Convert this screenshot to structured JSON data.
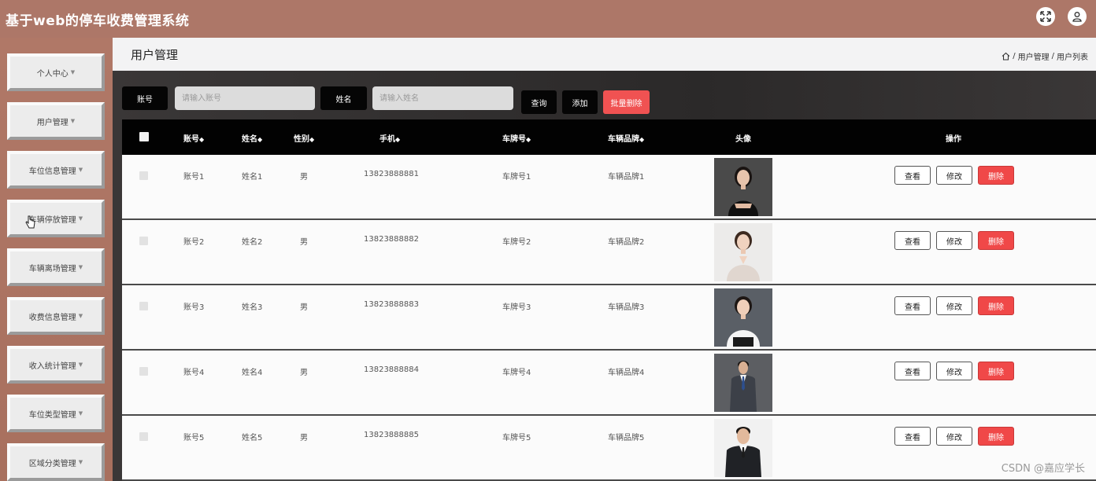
{
  "header": {
    "title": "基于web的停车收费管理系统",
    "icons": [
      "fullscreen-icon",
      "user-icon"
    ]
  },
  "sidebar": {
    "items": [
      {
        "label": "个人中心"
      },
      {
        "label": "用户管理"
      },
      {
        "label": "车位信息管理"
      },
      {
        "label": "车辆停放管理"
      },
      {
        "label": "车辆离场管理"
      },
      {
        "label": "收费信息管理"
      },
      {
        "label": "收入统计管理"
      },
      {
        "label": "车位类型管理"
      },
      {
        "label": "区域分类管理"
      }
    ]
  },
  "page": {
    "title": "用户管理",
    "breadcrumb": {
      "level1": "用户管理",
      "level2": "用户列表",
      "separator": "/"
    }
  },
  "search": {
    "account_label": "账号",
    "account_placeholder": "请输入账号",
    "name_label": "姓名",
    "name_placeholder": "请输入姓名",
    "query_button": "查询",
    "add_button": "添加",
    "batch_delete_button": "批量删除"
  },
  "table": {
    "columns": [
      "账号",
      "姓名",
      "性别",
      "手机",
      "车牌号",
      "车辆品牌",
      "头像",
      "操作"
    ],
    "sort_glyph": "◆",
    "rows": [
      {
        "account": "账号1",
        "name": "姓名1",
        "gender": "男",
        "phone": "13823888881",
        "plate": "车牌号1",
        "brand": "车辆品牌1"
      },
      {
        "account": "账号2",
        "name": "姓名2",
        "gender": "男",
        "phone": "13823888882",
        "plate": "车牌号2",
        "brand": "车辆品牌2"
      },
      {
        "account": "账号3",
        "name": "姓名3",
        "gender": "男",
        "phone": "13823888883",
        "plate": "车牌号3",
        "brand": "车辆品牌3"
      },
      {
        "account": "账号4",
        "name": "姓名4",
        "gender": "男",
        "phone": "13823888884",
        "plate": "车牌号4",
        "brand": "车辆品牌4"
      },
      {
        "account": "账号5",
        "name": "姓名5",
        "gender": "男",
        "phone": "13823888885",
        "plate": "车牌号5",
        "brand": "车辆品牌5"
      }
    ],
    "actions": {
      "view": "查看",
      "edit": "修改",
      "delete": "删除"
    }
  },
  "watermark": "CSDN @嘉应学长",
  "colors": {
    "header_bg": "#ad7768",
    "sidebar_bg": "#b07867",
    "delete_red": "#f05252",
    "table_header_bg": "#020202"
  }
}
